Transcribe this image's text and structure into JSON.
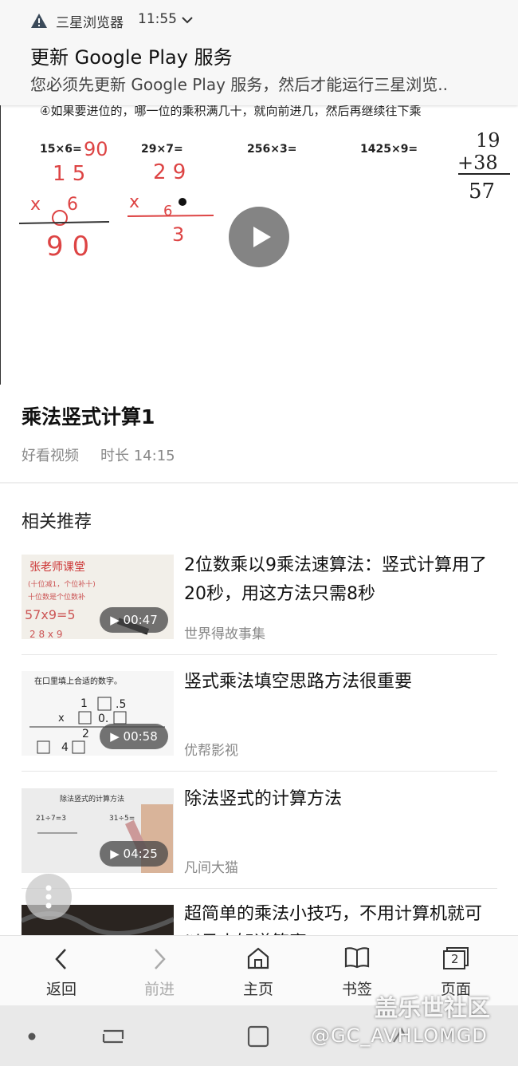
{
  "notification": {
    "app_name": "三星浏览器",
    "time": "11:55",
    "title": "更新 Google Play 服务",
    "body": "您必须先更新 Google Play 服务，然后才能运行三星浏览.."
  },
  "video": {
    "title": "乘法竖式计算1",
    "source": "好看视频",
    "duration": "时长 14:15",
    "board_texts": [
      "④如果要进位的，哪一位的乘积满几十，就向前进几，然后再继续往下乘",
      "15×6=",
      "29×7=",
      "256×3=",
      "1425×9=",
      "90",
      "19",
      "+38",
      "57"
    ]
  },
  "related": {
    "heading": "相关推荐",
    "items": [
      {
        "title": "2位数乘以9乘法速算法：竖式计算用了20秒，用这方法只需8秒",
        "source": "世界得故事集",
        "duration": "00:47"
      },
      {
        "title": "竖式乘法填空思路方法很重要",
        "source": "优帮影视",
        "duration": "00:58",
        "thumb_text": "在口里填上合适的数字。"
      },
      {
        "title": "除法竖式的计算方法",
        "source": "凡间大猫",
        "duration": "04:25",
        "thumb_text": "除法竖式的计算方法"
      },
      {
        "title": "超简单的乘法小技巧，不用计算机就可以马上知道答案",
        "source": "",
        "duration": ""
      }
    ]
  },
  "toolbar": {
    "back": "返回",
    "forward": "前进",
    "home": "主页",
    "bookmarks": "书签",
    "pages": "页面",
    "tab_count": "2"
  },
  "watermark": {
    "line1": "盖乐世社区",
    "line2": "@GC_AVHLOMGD"
  }
}
